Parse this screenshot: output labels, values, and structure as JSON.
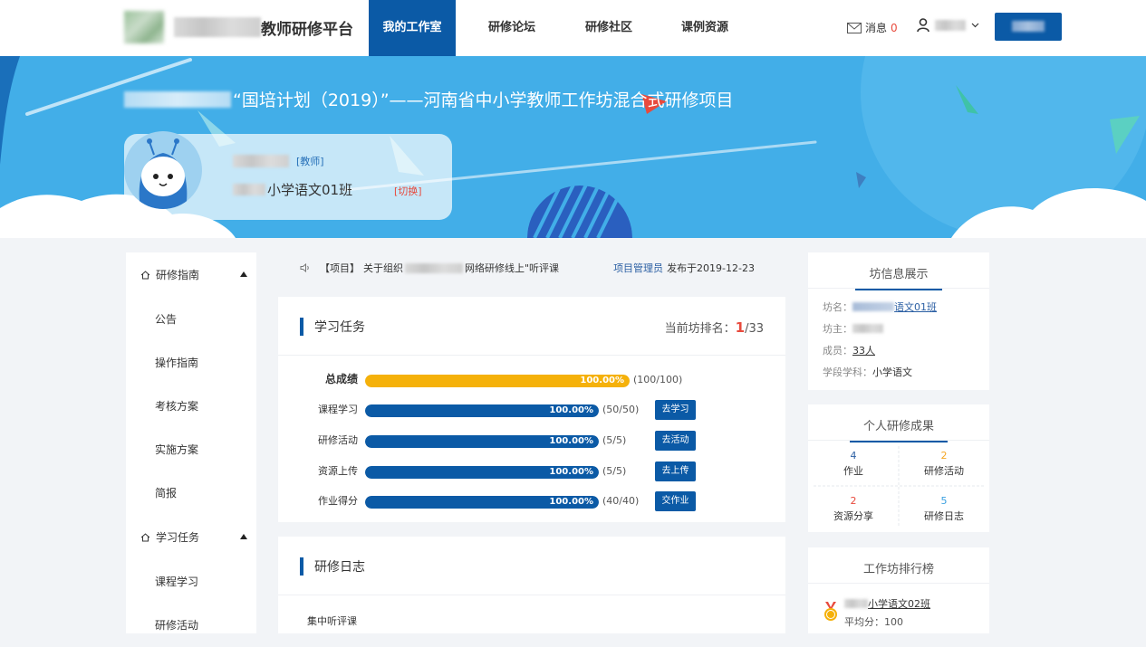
{
  "header": {
    "site_title": "教师研修平台",
    "nav": [
      {
        "label": "我的工作室",
        "active": true
      },
      {
        "label": "研修论坛",
        "active": false
      },
      {
        "label": "研修社区",
        "active": false
      },
      {
        "label": "课例资源",
        "active": false
      }
    ],
    "messages_label": "消息",
    "messages_count": "0"
  },
  "banner": {
    "title": "“国培计划（2019）”——河南省中小学教师工作坊混合式研修项目",
    "role": "[教师]",
    "class_name": "小学语文01班",
    "switch_label": "[切换]"
  },
  "sidebar": {
    "groups": [
      {
        "label": "研修指南",
        "items": [
          "公告",
          "操作指南",
          "考核方案",
          "实施方案",
          "简报"
        ]
      },
      {
        "label": "学习任务",
        "items": [
          "课程学习",
          "研修活动"
        ]
      }
    ]
  },
  "notice": {
    "tag": "【项目】",
    "text_prefix": "关于组织",
    "text_suffix": "网络研修线上\"听评课",
    "publisher": "项目管理员",
    "date_text": "发布于2019-12-23"
  },
  "tasks": {
    "title": "学习任务",
    "rank_label": "当前坊排名：",
    "rank_value": "1",
    "rank_total": "/33",
    "rows": [
      {
        "label": "总成绩",
        "percent_text": "100.00%",
        "progress": 1.0,
        "score": "(100/100)",
        "action": "",
        "main": true
      },
      {
        "label": "课程学习",
        "percent_text": "100.00%",
        "progress": 1.0,
        "score": "(50/50)",
        "action": "去学习",
        "main": false
      },
      {
        "label": "研修活动",
        "percent_text": "100.00%",
        "progress": 1.0,
        "score": "(5/5)",
        "action": "去活动",
        "main": false
      },
      {
        "label": "资源上传",
        "percent_text": "100.00%",
        "progress": 1.0,
        "score": "(5/5)",
        "action": "去上传",
        "main": false
      },
      {
        "label": "作业得分",
        "percent_text": "100.00%",
        "progress": 1.0,
        "score": "(40/40)",
        "action": "交作业",
        "main": false
      }
    ]
  },
  "diary": {
    "title": "研修日志",
    "first_item": "集中听评课"
  },
  "workshop_info": {
    "title": "坊信息展示",
    "name_label": "坊名：",
    "name_value": "语文01班",
    "owner_label": "坊主：",
    "members_label": "成员：",
    "members_value": "33人",
    "subject_label": "学段学科：",
    "subject_value": "小学语文"
  },
  "achievements": {
    "title": "个人研修成果",
    "items": [
      {
        "count": "4",
        "label": "作业",
        "color": "#2b5fa3"
      },
      {
        "count": "2",
        "label": "研修活动",
        "color": "#f5a623"
      },
      {
        "count": "2",
        "label": "资源分享",
        "color": "#e84a3d"
      },
      {
        "count": "5",
        "label": "研修日志",
        "color": "#3aa0e0"
      }
    ]
  },
  "ranking": {
    "title": "工作坊排行榜",
    "first_name": "小学语文02班",
    "first_avg": "平均分：100"
  },
  "colors": {
    "primary": "#0b5aa6",
    "banner": "#42aee8",
    "total_bar": "#f5b10a",
    "accent_red": "#e84a3d"
  }
}
